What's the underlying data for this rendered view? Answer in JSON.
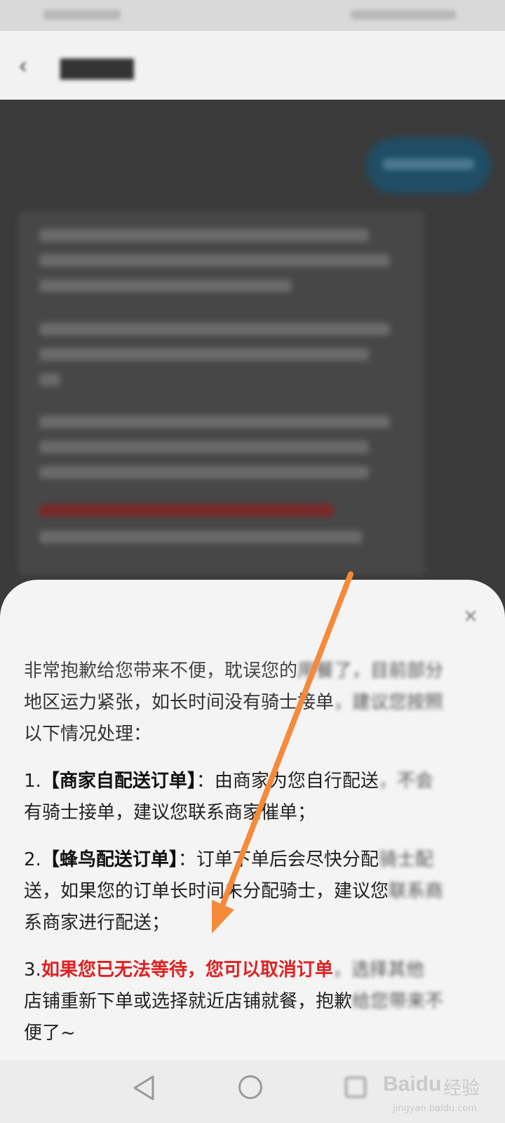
{
  "sheet": {
    "p1": {
      "line1_a": "非常抱歉给您带来不便，耽误您的",
      "line1_b": "用餐了，目前部分",
      "line2_a": "地区运力紧张，如长时间没有骑士接单",
      "line2_b": "，建议您按照",
      "line3": "以下情况处理："
    },
    "p2": {
      "num": "1.",
      "bold": "【商家自配送订单】",
      "text1_a": "：由商家为您自行配送",
      "text1_b": "，不会",
      "text2": "有骑士接单，建议您联系商家催单；"
    },
    "p3": {
      "num": "2.",
      "bold": "【蜂鸟配送订单】",
      "text1_a": "：订单下单后会尽快分配",
      "text1_b": "骑士配",
      "text2_a": "送，如果您的订单长时间未分配骑士，建议您",
      "text2_b": "联系商",
      "text3": "系商家进行配送；"
    },
    "p4": {
      "num": "3.",
      "red": "如果您已无法等待，您可以取消订单",
      "text1_b": "，选择其他",
      "text2_a": "店铺重新下单或选择就近店铺就餐，抱歉",
      "text2_b": "给您带来不",
      "text3": "便了~"
    }
  },
  "watermark": {
    "logo": "Baidu",
    "text": "经验",
    "url": "jingyan.baidu.com"
  },
  "colors": {
    "accent_red": "#e02020",
    "arrow": "#f58a3a",
    "bubble": "#1f4e66"
  },
  "icons": {
    "back": "chevron-left-icon",
    "close": "close-icon",
    "nav_back": "triangle-back-icon",
    "nav_home": "circle-home-icon",
    "nav_recent": "square-recent-icon"
  }
}
